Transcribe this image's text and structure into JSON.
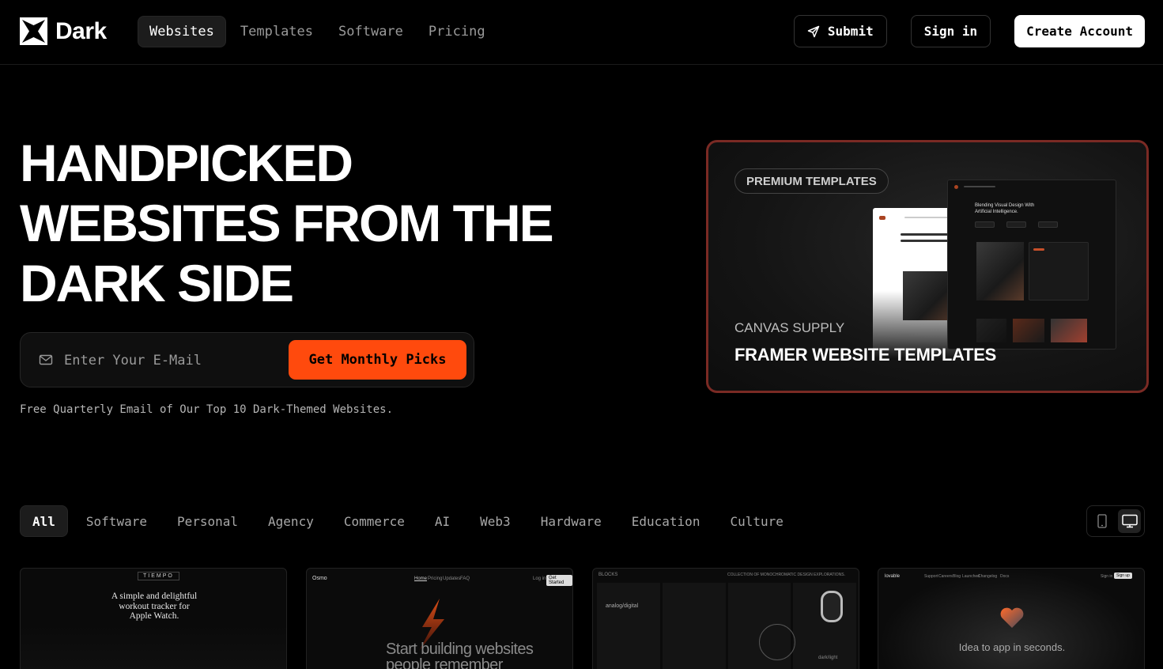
{
  "brand": {
    "name": "Dark"
  },
  "nav": {
    "links": [
      "Websites",
      "Templates",
      "Software",
      "Pricing"
    ],
    "active": "Websites",
    "submit_label": "Submit",
    "signin_label": "Sign in",
    "create_label": "Create Account"
  },
  "hero": {
    "title_lines": [
      "HANDPICKED",
      "WEBSITES FROM THE",
      "DARK SIDE"
    ],
    "email_placeholder": "Enter Your E-Mail",
    "cta_label": "Get Monthly Picks",
    "note": "Free Quarterly Email of Our Top 10 Dark-Themed Websites."
  },
  "promo": {
    "badge": "PREMIUM TEMPLATES",
    "subtitle": "CANVAS SUPPLY",
    "title": "FRAMER WEBSITE TEMPLATES",
    "mock_heading": "Blending Visual Design With Artificial Intelligence."
  },
  "filters": {
    "items": [
      "All",
      "Software",
      "Personal",
      "Agency",
      "Commerce",
      "AI",
      "Web3",
      "Hardware",
      "Education",
      "Culture"
    ],
    "active": "All"
  },
  "cards": [
    {
      "brand": "TIEMPO",
      "headline": "A simple and delightful workout tracker for Apple Watch."
    },
    {
      "brand": "Osmo",
      "headline": "Start building websites people remember",
      "nav": [
        "Home",
        "Pricing",
        "Updates",
        "FAQ"
      ],
      "login": "Log in",
      "cta": "Get Started"
    },
    {
      "brand": "BLOCKS",
      "headline": "COLLECTION OF MONOCHROMATIC DESIGN EXPLORATIONS.",
      "tag": "analog/digital",
      "footer": "dark/light"
    },
    {
      "brand": "lovable",
      "headline": "Idea to app in seconds.",
      "nav": [
        "Support",
        "Careers",
        "Blog",
        "Launched",
        "Changelog",
        "Docs"
      ],
      "signin": "Sign in",
      "signup": "Sign up"
    }
  ],
  "colors": {
    "accent": "#ff4a0d",
    "promo_border": "#7a2a24",
    "background": "#000000"
  }
}
